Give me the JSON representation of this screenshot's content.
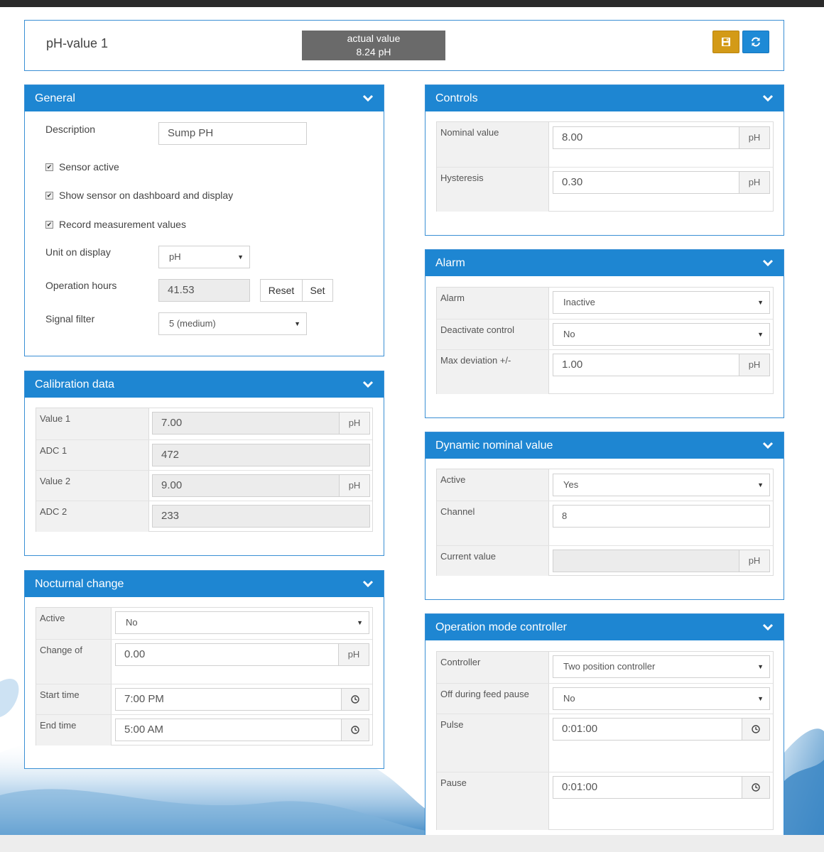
{
  "header": {
    "title": "pH-value 1",
    "actual_label": "actual value",
    "actual_value": "8.24 pH",
    "icons": [
      "save-icon",
      "refresh-icon"
    ],
    "colors": {
      "save": "#d39a17",
      "refresh": "#1e8ad6",
      "panel_header": "#1e86d2"
    }
  },
  "general": {
    "title": "General",
    "description_label": "Description",
    "description_value": "Sump PH",
    "checkboxes": [
      {
        "label": "Sensor active",
        "checked": true
      },
      {
        "label": "Show sensor on dashboard and display",
        "checked": true
      },
      {
        "label": "Record measurement values",
        "checked": true
      }
    ],
    "unit_label": "Unit on display",
    "unit_value": "pH",
    "hours_label": "Operation hours",
    "hours_value": "41.53",
    "reset_label": "Reset",
    "set_label": "Set",
    "filter_label": "Signal filter",
    "filter_value": "5 (medium)"
  },
  "calibration": {
    "title": "Calibration data",
    "rows": [
      {
        "label": "Value 1",
        "value": "7.00",
        "unit": "pH"
      },
      {
        "label": "ADC 1",
        "value": "472",
        "unit": ""
      },
      {
        "label": "Value 2",
        "value": "9.00",
        "unit": "pH"
      },
      {
        "label": "ADC 2",
        "value": "233",
        "unit": ""
      }
    ]
  },
  "nocturnal": {
    "title": "Nocturnal change",
    "active_label": "Active",
    "active_value": "No",
    "change_label": "Change of",
    "change_value": "0.00",
    "change_unit": "pH",
    "start_label": "Start time",
    "start_value": "7:00 PM",
    "end_label": "End time",
    "end_value": "5:00 AM"
  },
  "controls": {
    "title": "Controls",
    "nominal_label": "Nominal value",
    "nominal_value": "8.00",
    "nominal_unit": "pH",
    "hyst_label": "Hysteresis",
    "hyst_value": "0.30",
    "hyst_unit": "pH"
  },
  "alarm": {
    "title": "Alarm",
    "alarm_label": "Alarm",
    "alarm_value": "Inactive",
    "deact_label": "Deactivate control",
    "deact_value": "No",
    "maxdev_label": "Max deviation +/-",
    "maxdev_value": "1.00",
    "maxdev_unit": "pH"
  },
  "dynamic": {
    "title": "Dynamic nominal value",
    "active_label": "Active",
    "active_value": "Yes",
    "channel_label": "Channel",
    "channel_value": "8",
    "current_label": "Current value",
    "current_value": "",
    "current_unit": "pH"
  },
  "opmode": {
    "title": "Operation mode controller",
    "controller_label": "Controller",
    "controller_value": "Two position controller",
    "offfeed_label": "Off during feed pause",
    "offfeed_value": "No",
    "pulse_label": "Pulse",
    "pulse_value": "0:01:00",
    "pause_label": "Pause",
    "pause_value": "0:01:00"
  }
}
